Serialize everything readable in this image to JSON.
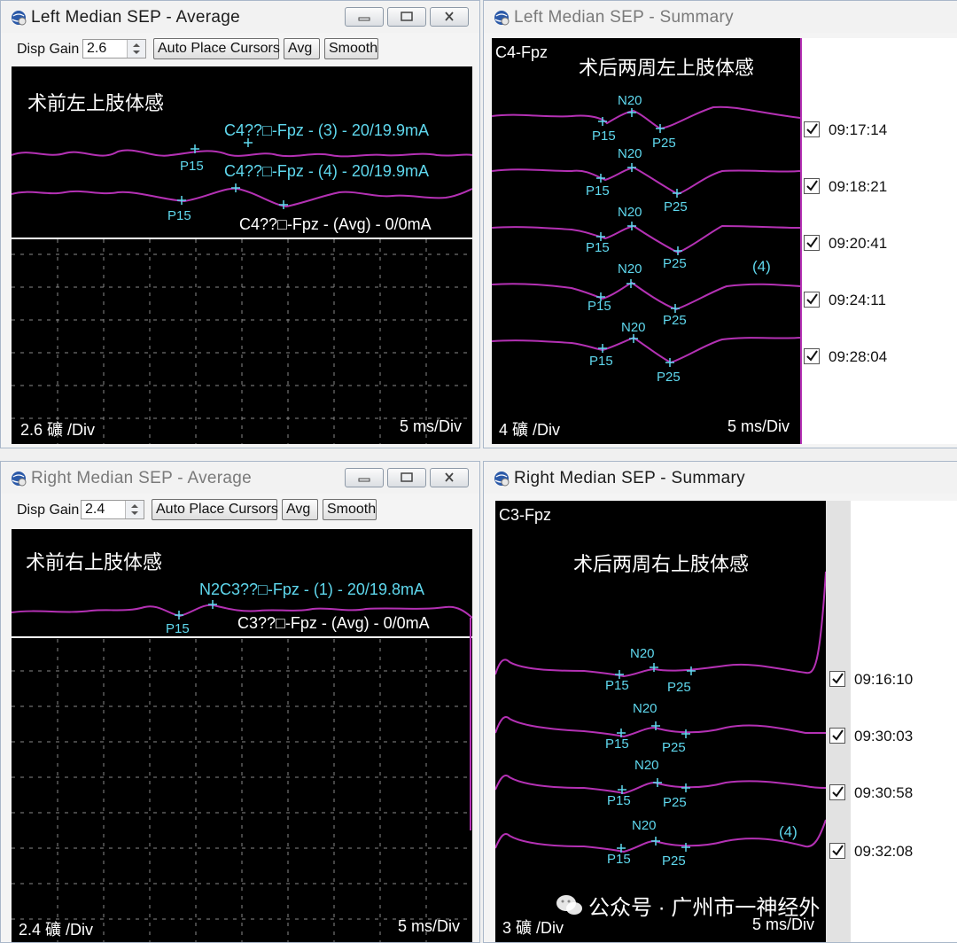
{
  "windows": {
    "left_avg": {
      "title": "Left Median SEP - Average",
      "disp_gain_label": "Disp Gain",
      "disp_gain_value": "2.6",
      "auto_place_label": "Auto Place Cursors",
      "avg_label": "Avg",
      "smooth_label": "Smooth",
      "chinese_label": "术前左上肢体感",
      "trace1_label": "C4??□-Fpz - (3) - 20/19.9mA",
      "trace2_label": "C4??□-Fpz - (4) - 20/19.9mA",
      "avg_trace_label": "C4??□-Fpz - (Avg) - 0/0mA",
      "markers": [
        "P15",
        "P15"
      ],
      "scale_left": "2.6 礦 /Div",
      "scale_right": "5 ms/Div"
    },
    "left_summary": {
      "title": "Left Median SEP - Summary",
      "channel": "C4-Fpz",
      "chinese_label": "术后两周左上肢体感",
      "count_label": "(4)",
      "rows": [
        {
          "time": "09:17:14",
          "checked": true,
          "m1": "P15",
          "m2": "N20",
          "m3": "P25"
        },
        {
          "time": "09:18:21",
          "checked": true,
          "m1": "P15",
          "m2": "N20",
          "m3": "P25"
        },
        {
          "time": "09:20:41",
          "checked": true,
          "m1": "P15",
          "m2": "N20",
          "m3": "P25"
        },
        {
          "time": "09:24:11",
          "checked": true,
          "m1": "P15",
          "m2": "N20",
          "m3": "P25"
        },
        {
          "time": "09:28:04",
          "checked": true,
          "m1": "P15",
          "m2": "N20",
          "m3": "P25"
        }
      ],
      "scale_left": "4 礦 /Div",
      "scale_right": "5 ms/Div"
    },
    "right_avg": {
      "title": "Right Median SEP - Average",
      "disp_gain_label": "Disp Gain",
      "disp_gain_value": "2.4",
      "auto_place_label": "Auto Place Cursors",
      "avg_label": "Avg",
      "smooth_label": "Smooth",
      "chinese_label": "术前右上肢体感",
      "trace1_label": "N2C3??□-Fpz - (1) - 20/19.8mA",
      "avg_trace_label": "C3??□-Fpz - (Avg) - 0/0mA",
      "markers": [
        "P15"
      ],
      "scale_left": "2.4 礦 /Div",
      "scale_right": "5 ms/Div"
    },
    "right_summary": {
      "title": "Right Median SEP - Summary",
      "channel": "C3-Fpz",
      "chinese_label": "术后两周右上肢体感",
      "count_label": "(4)",
      "rows": [
        {
          "time": "09:16:10",
          "checked": true,
          "m1": "P15",
          "m2": "N20",
          "m3": "P25"
        },
        {
          "time": "09:30:03",
          "checked": true,
          "m1": "P15",
          "m2": "N20",
          "m3": "P25"
        },
        {
          "time": "09:30:58",
          "checked": true,
          "m1": "P15",
          "m2": "N20",
          "m3": "P25"
        },
        {
          "time": "09:32:08",
          "checked": true,
          "m1": "P15",
          "m2": "N20",
          "m3": "P25"
        }
      ],
      "scale_left": "3 礦 /Div",
      "scale_right": "5 ms/Div"
    }
  },
  "watermark": "公众号 · 广州市一神经外",
  "colors": {
    "trace": "#b431b4",
    "marker": "#5fd8ee",
    "grid": "#8a8a8a",
    "background": "#000000"
  }
}
